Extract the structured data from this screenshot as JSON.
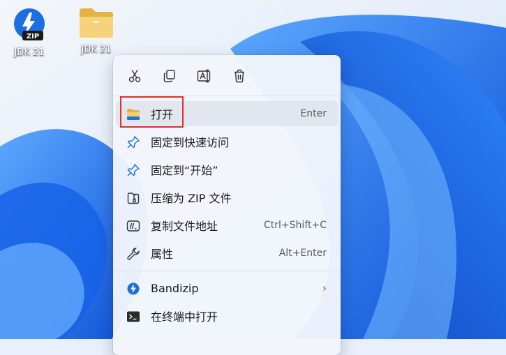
{
  "desktop": {
    "icons": [
      {
        "label": "JDK 21",
        "icon": "zip-file-icon",
        "badge": "ZIP"
      },
      {
        "label": "JDK 21",
        "icon": "folder-icon"
      }
    ]
  },
  "context_menu": {
    "quick_actions": [
      {
        "name": "cut",
        "icon": "scissors-icon"
      },
      {
        "name": "copy",
        "icon": "copy-icon"
      },
      {
        "name": "rename",
        "icon": "rename-icon"
      },
      {
        "name": "delete",
        "icon": "trash-icon"
      }
    ],
    "items": [
      {
        "label": "打开",
        "shortcut": "Enter",
        "icon": "folder-icon"
      },
      {
        "label": "固定到快速访问",
        "shortcut": "",
        "icon": "pin-icon"
      },
      {
        "label": "固定到“开始”",
        "shortcut": "",
        "icon": "pin-icon"
      },
      {
        "label": "压缩为 ZIP 文件",
        "shortcut": "",
        "icon": "zip-archive-icon"
      },
      {
        "label": "复制文件地址",
        "shortcut": "Ctrl+Shift+C",
        "icon": "path-icon"
      },
      {
        "label": "属性",
        "shortcut": "Alt+Enter",
        "icon": "wrench-icon"
      },
      {
        "label": "Bandizip",
        "shortcut": "",
        "icon": "bandizip-icon",
        "has_submenu": true
      },
      {
        "label": "在终端中打开",
        "shortcut": "",
        "icon": "terminal-icon"
      }
    ]
  },
  "colors": {
    "accent": "#1a6fe0",
    "highlight_border": "#e0302c"
  }
}
